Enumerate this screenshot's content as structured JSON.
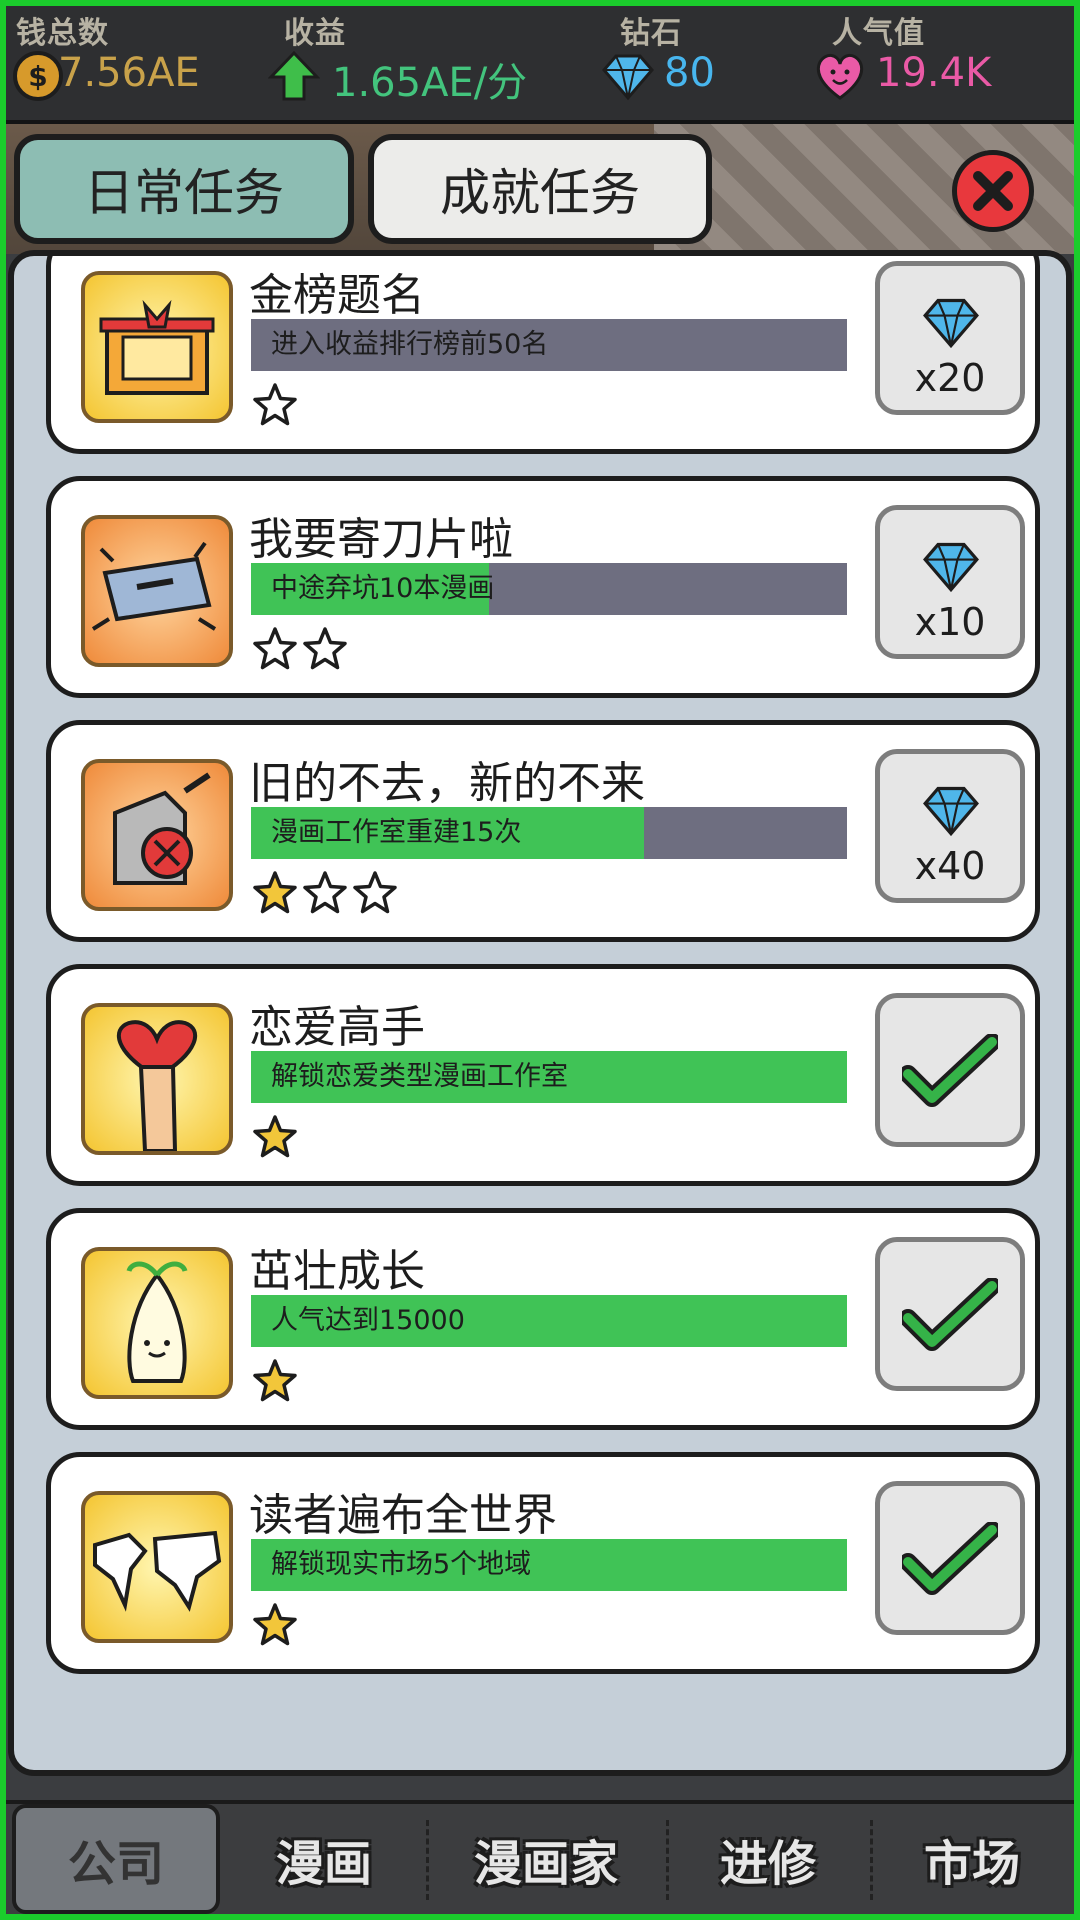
{
  "stats": [
    {
      "label": "钱总数",
      "value": "7.56AE",
      "icon": "coin-icon",
      "color": "#c9a24a"
    },
    {
      "label": "收益",
      "value": "1.65AE/分",
      "icon": "arrow-up-icon",
      "color": "#43c47d"
    },
    {
      "label": "钻石",
      "value": "80",
      "icon": "diamond-icon",
      "color": "#48b6ee"
    },
    {
      "label": "人气值",
      "value": "19.4K",
      "icon": "heart-icon",
      "color": "#ea5aa6"
    }
  ],
  "tabs": {
    "daily": "日常任务",
    "achievement": "成就任务",
    "active": "achievement"
  },
  "tasks": [
    {
      "title": "金榜题名",
      "desc": "进入收益排行榜前50名",
      "progress": 0.0,
      "stars_total": 1,
      "stars_filled": 0,
      "reward": "x20",
      "completed": false,
      "icon": "ranking-banner-icon"
    },
    {
      "title": "我要寄刀片啦",
      "desc": "中途弃坑10本漫画",
      "progress": 0.4,
      "stars_total": 2,
      "stars_filled": 0,
      "reward": "x10",
      "completed": false,
      "icon": "razor-blade-icon"
    },
    {
      "title": "旧的不去，新的不来",
      "desc": "漫画工作室重建15次",
      "progress": 0.66,
      "stars_total": 3,
      "stars_filled": 1,
      "reward": "x40",
      "completed": false,
      "icon": "demolition-icon"
    },
    {
      "title": "恋爱高手",
      "desc": "解锁恋爱类型漫画工作室",
      "progress": 1.0,
      "stars_total": 1,
      "stars_filled": 1,
      "reward": "",
      "completed": true,
      "icon": "heart-in-hand-icon"
    },
    {
      "title": "茁壮成长",
      "desc": "人气达到15000",
      "progress": 1.0,
      "stars_total": 1,
      "stars_filled": 1,
      "reward": "",
      "completed": true,
      "icon": "sprout-icon"
    },
    {
      "title": "读者遍布全世界",
      "desc": "解锁现实市场5个地域",
      "progress": 1.0,
      "stars_total": 1,
      "stars_filled": 1,
      "reward": "",
      "completed": true,
      "icon": "world-map-icon"
    }
  ],
  "nav": [
    {
      "label": "公司",
      "active": true
    },
    {
      "label": "漫画",
      "active": false
    },
    {
      "label": "漫画家",
      "active": false
    },
    {
      "label": "进修",
      "active": false
    },
    {
      "label": "市场",
      "active": false
    }
  ],
  "colors": {
    "progress_fill": "#40c356",
    "progress_track": "#6e6e80",
    "tab_active": "#8dbdb3",
    "close": "#e8383d",
    "gem": "#4fb6ea",
    "check": "#35b348",
    "star_filled": "#f2c63a"
  }
}
